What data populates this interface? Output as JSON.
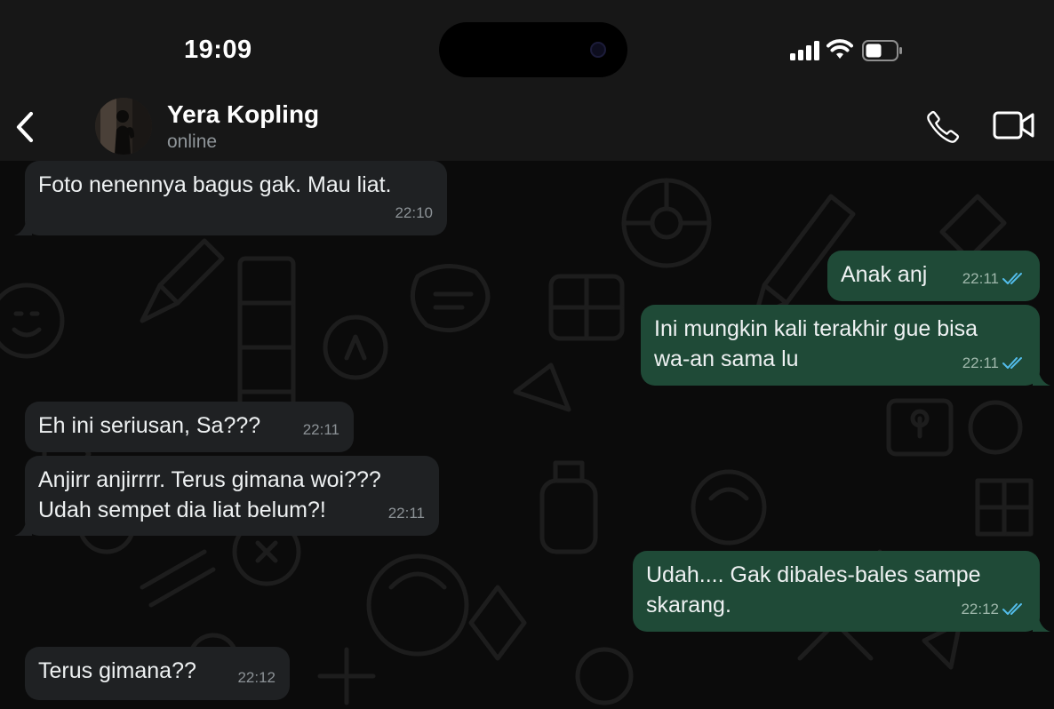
{
  "status_bar": {
    "time": "19:09"
  },
  "header": {
    "name": "Yera Kopling",
    "status": "online"
  },
  "messages": [
    {
      "dir": "in",
      "text": "Foto nenennya bagus gak. Mau liat.",
      "time": "22:10"
    },
    {
      "dir": "out",
      "text": "Anak anj",
      "time": "22:11",
      "read": true
    },
    {
      "dir": "out",
      "text": "Ini mungkin kali terakhir gue bisa\nwa-an sama lu",
      "time": "22:11",
      "read": true
    },
    {
      "dir": "in",
      "text": "Eh ini seriusan, Sa???",
      "time": "22:11"
    },
    {
      "dir": "in",
      "text": "Anjirr anjirrrr. Terus gimana woi???\nUdah sempet dia liat belum?!",
      "time": "22:11"
    },
    {
      "dir": "out",
      "text": "Udah.... Gak dibales-bales sampe\nskarang.",
      "time": "22:12",
      "read": true
    },
    {
      "dir": "in",
      "text": "Terus gimana??",
      "time": "22:12"
    }
  ],
  "icons": {
    "back": "chevron-left-icon",
    "call": "phone-icon",
    "video": "video-camera-icon",
    "signal": "cellular-signal-icon",
    "wifi": "wifi-icon",
    "battery": "battery-icon",
    "read": "double-check-icon"
  },
  "colors": {
    "incoming_bubble": "#1f2123",
    "outgoing_bubble": "#1f4a37",
    "read_ticks": "#53bdeb",
    "header_bg": "#171717",
    "chat_bg": "#0b0b0b"
  }
}
